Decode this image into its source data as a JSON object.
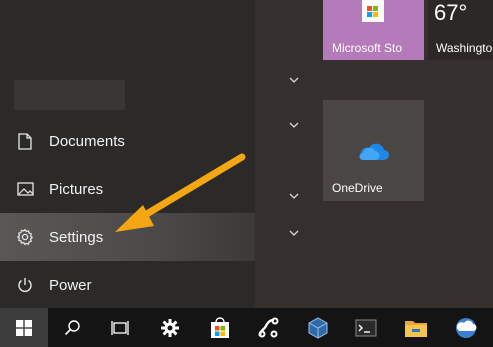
{
  "start_menu": {
    "items": [
      {
        "label": "Documents",
        "icon": "document-icon"
      },
      {
        "label": "Pictures",
        "icon": "pictures-icon"
      },
      {
        "label": "Settings",
        "icon": "gear-icon",
        "highlighted": true
      },
      {
        "label": "Power",
        "icon": "power-icon"
      }
    ]
  },
  "tiles": {
    "store": {
      "label": "Microsoft Sto",
      "icon": "store-icon",
      "color": "#b57aba"
    },
    "weather": {
      "temp": "67°",
      "label": "Washingto"
    },
    "onedrive": {
      "label": "OneDrive",
      "icon": "cloud-icon"
    }
  },
  "taskbar": {
    "items": [
      "start-icon",
      "search-icon",
      "task-view-icon",
      "settings-icon",
      "store-icon",
      "app-icon",
      "virtualbox-icon",
      "terminal-icon",
      "file-explorer-icon",
      "app-icon"
    ]
  },
  "annotation": {
    "arrow_color": "#f4a712"
  },
  "colors": {
    "accent": "#b57aba",
    "taskbar": "#141414"
  }
}
